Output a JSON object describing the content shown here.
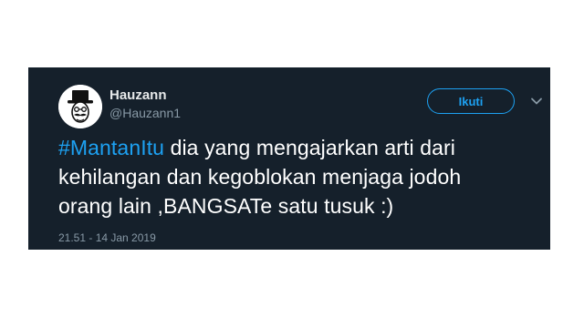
{
  "user": {
    "display_name": "Hauzann",
    "handle": "@Hauzann1"
  },
  "follow_button_label": "Ikuti",
  "tweet": {
    "hashtag": "#MantanItu",
    "text_line1": " dia yang mengajarkan arti dari",
    "text_line2": "kehilangan dan kegoblokan menjaga jodoh",
    "text_line3": "orang lain ,BANGSATe satu tusuk :)"
  },
  "timestamp": "21.51 - 14 Jan 2019",
  "icons": {
    "avatar": "man-with-top-hat-and-mustache-avatar",
    "caret": "chevron-down-icon"
  },
  "colors": {
    "card_background": "#15202b",
    "accent": "#1da1f2",
    "primary_text": "#ffffff",
    "secondary_text": "#8899a6"
  }
}
